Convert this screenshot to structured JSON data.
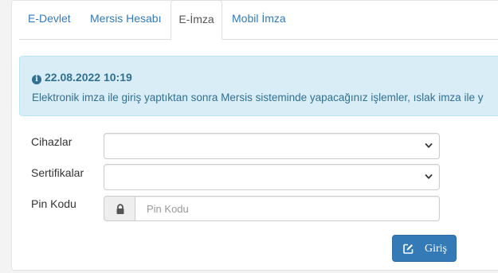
{
  "tabs": [
    {
      "label": "E-Devlet",
      "active": false
    },
    {
      "label": "Mersis Hesabı",
      "active": false
    },
    {
      "label": "E-İmza",
      "active": true
    },
    {
      "label": "Mobil İmza",
      "active": false
    }
  ],
  "alert": {
    "icon": "info-icon",
    "title": "22.08.2022 10:19",
    "text": "Elektronik imza ile giriş yaptıktan sonra Mersis sisteminde yapacağınız işlemler, ıslak imza ile y"
  },
  "form": {
    "devices_label": "Cihazlar",
    "devices_value": "",
    "certificates_label": "Sertifikalar",
    "certificates_value": "",
    "pin_label": "Pin Kodu",
    "pin_placeholder": "Pin Kodu",
    "pin_value": "",
    "pin_icon": "lock-icon"
  },
  "submit": {
    "label": "Giriş",
    "icon": "edit-icon"
  },
  "colors": {
    "link": "#337ab7",
    "alert_bg": "#d9edf7",
    "alert_text": "#31708f",
    "button_bg": "#337ab7"
  }
}
